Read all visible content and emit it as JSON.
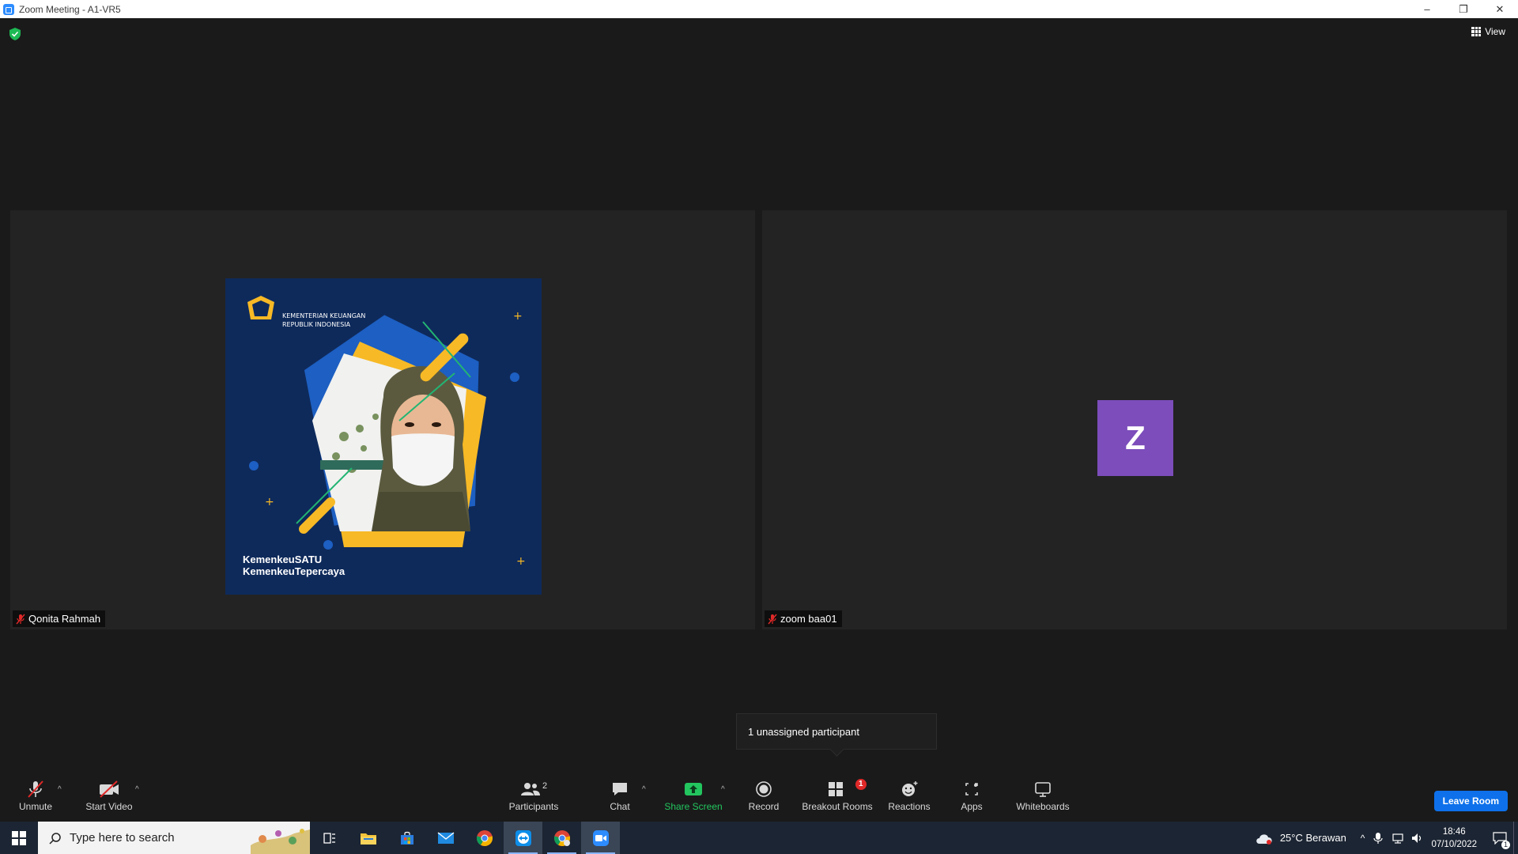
{
  "window": {
    "title": "Zoom Meeting - A1-VR5",
    "minimize": "–",
    "restore": "❐",
    "close": "✕"
  },
  "meeting": {
    "view_label": "View",
    "tiles": [
      {
        "name": "Qonita Rahmah"
      },
      {
        "name": "zoom baa01",
        "avatar_letter": "Z"
      }
    ],
    "profile_pic": {
      "org_line1": "KEMENTERIAN KEUANGAN",
      "org_line2": "REPUBLIK INDONESIA",
      "tag1": "KemenkeuSATU",
      "tag2": "KemenkeuTepercaya"
    },
    "tooltip": "1 unassigned participant"
  },
  "toolbar": {
    "unmute": "Unmute",
    "start_video": "Start Video",
    "participants": "Participants",
    "participants_count": "2",
    "chat": "Chat",
    "share_screen": "Share Screen",
    "record": "Record",
    "breakout_rooms": "Breakout Rooms",
    "breakout_badge": "1",
    "reactions": "Reactions",
    "apps": "Apps",
    "whiteboards": "Whiteboards",
    "leave": "Leave Room"
  },
  "taskbar": {
    "search_placeholder": "Type here to search",
    "weather": "25°C  Berawan",
    "time": "18:46",
    "date": "07/10/2022",
    "notification_count": "1"
  },
  "colors": {
    "accent_blue": "#0e71eb",
    "share_green": "#22c55e",
    "avatar_purple": "#7c4dbb",
    "badge_red": "#e02828"
  }
}
